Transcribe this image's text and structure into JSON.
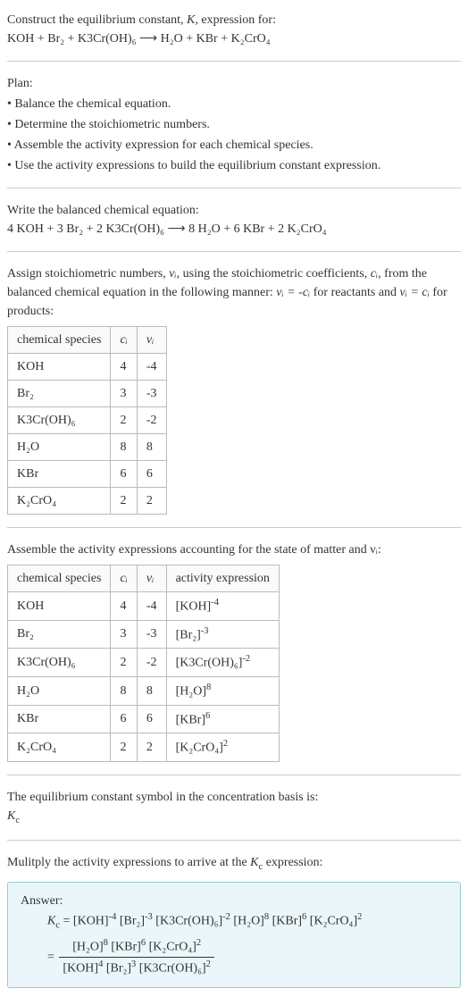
{
  "header": {
    "title_1": "Construct the equilibrium constant, ",
    "title_k": "K",
    "title_2": ", expression for:",
    "equation_unbalanced": "KOH + Br₂ + K3Cr(OH)₆ ⟶ H₂O + KBr + K₂CrO₄"
  },
  "plan": {
    "label": "Plan:",
    "items": [
      "• Balance the chemical equation.",
      "• Determine the stoichiometric numbers.",
      "• Assemble the activity expression for each chemical species.",
      "• Use the activity expressions to build the equilibrium constant expression."
    ]
  },
  "balanced": {
    "label": "Write the balanced chemical equation:",
    "equation": "4 KOH + 3 Br₂ + 2 K3Cr(OH)₆ ⟶ 8 H₂O + 6 KBr + 2 K₂CrO₄"
  },
  "stoich_intro": {
    "part1": "Assign stoichiometric numbers, ",
    "nu_i": "νᵢ",
    "part2": ", using the stoichiometric coefficients, ",
    "c_i": "cᵢ",
    "part3": ", from the balanced chemical equation in the following manner: ",
    "rel1": "νᵢ = -cᵢ",
    "part4": " for reactants and ",
    "rel2": "νᵢ = cᵢ",
    "part5": " for products:"
  },
  "table1": {
    "headers": [
      "chemical species",
      "cᵢ",
      "νᵢ"
    ],
    "rows": [
      {
        "species": "KOH",
        "c": "4",
        "nu": "-4"
      },
      {
        "species": "Br₂",
        "c": "3",
        "nu": "-3"
      },
      {
        "species": "K3Cr(OH)₆",
        "c": "2",
        "nu": "-2"
      },
      {
        "species": "H₂O",
        "c": "8",
        "nu": "8"
      },
      {
        "species": "KBr",
        "c": "6",
        "nu": "6"
      },
      {
        "species": "K₂CrO₄",
        "c": "2",
        "nu": "2"
      }
    ]
  },
  "activity_intro": "Assemble the activity expressions accounting for the state of matter and νᵢ:",
  "table2": {
    "headers": [
      "chemical species",
      "cᵢ",
      "νᵢ",
      "activity expression"
    ],
    "rows": [
      {
        "species": "KOH",
        "c": "4",
        "nu": "-4",
        "expr_base": "[KOH]",
        "expr_sup": "-4"
      },
      {
        "species": "Br₂",
        "c": "3",
        "nu": "-3",
        "expr_base": "[Br₂]",
        "expr_sup": "-3"
      },
      {
        "species": "K3Cr(OH)₆",
        "c": "2",
        "nu": "-2",
        "expr_base": "[K3Cr(OH)₆]",
        "expr_sup": "-2"
      },
      {
        "species": "H₂O",
        "c": "8",
        "nu": "8",
        "expr_base": "[H₂O]",
        "expr_sup": "8"
      },
      {
        "species": "KBr",
        "c": "6",
        "nu": "6",
        "expr_base": "[KBr]",
        "expr_sup": "6"
      },
      {
        "species": "K₂CrO₄",
        "c": "2",
        "nu": "2",
        "expr_base": "[K₂CrO₄]",
        "expr_sup": "2"
      }
    ]
  },
  "kc_symbol": {
    "line1": "The equilibrium constant symbol in the concentration basis is:",
    "symbol": "K_c"
  },
  "multiply": "Mulitply the activity expressions to arrive at the K_c expression:",
  "answer": {
    "label": "Answer:",
    "lhs": "K_c = ",
    "flat": {
      "t1": "[KOH]",
      "s1": "-4",
      "t2": "[Br₂]",
      "s2": "-3",
      "t3": "[K3Cr(OH)₆]",
      "s3": "-2",
      "t4": "[H₂O]",
      "s4": "8",
      "t5": "[KBr]",
      "s5": "6",
      "t6": "[K₂CrO₄]",
      "s6": "2"
    },
    "frac": {
      "num": {
        "t1": "[H₂O]",
        "s1": "8",
        "t2": "[KBr]",
        "s2": "6",
        "t3": "[K₂CrO₄]",
        "s3": "2"
      },
      "den": {
        "t1": "[KOH]",
        "s1": "4",
        "t2": "[Br₂]",
        "s2": "3",
        "t3": "[K3Cr(OH)₆]",
        "s3": "2"
      }
    }
  }
}
